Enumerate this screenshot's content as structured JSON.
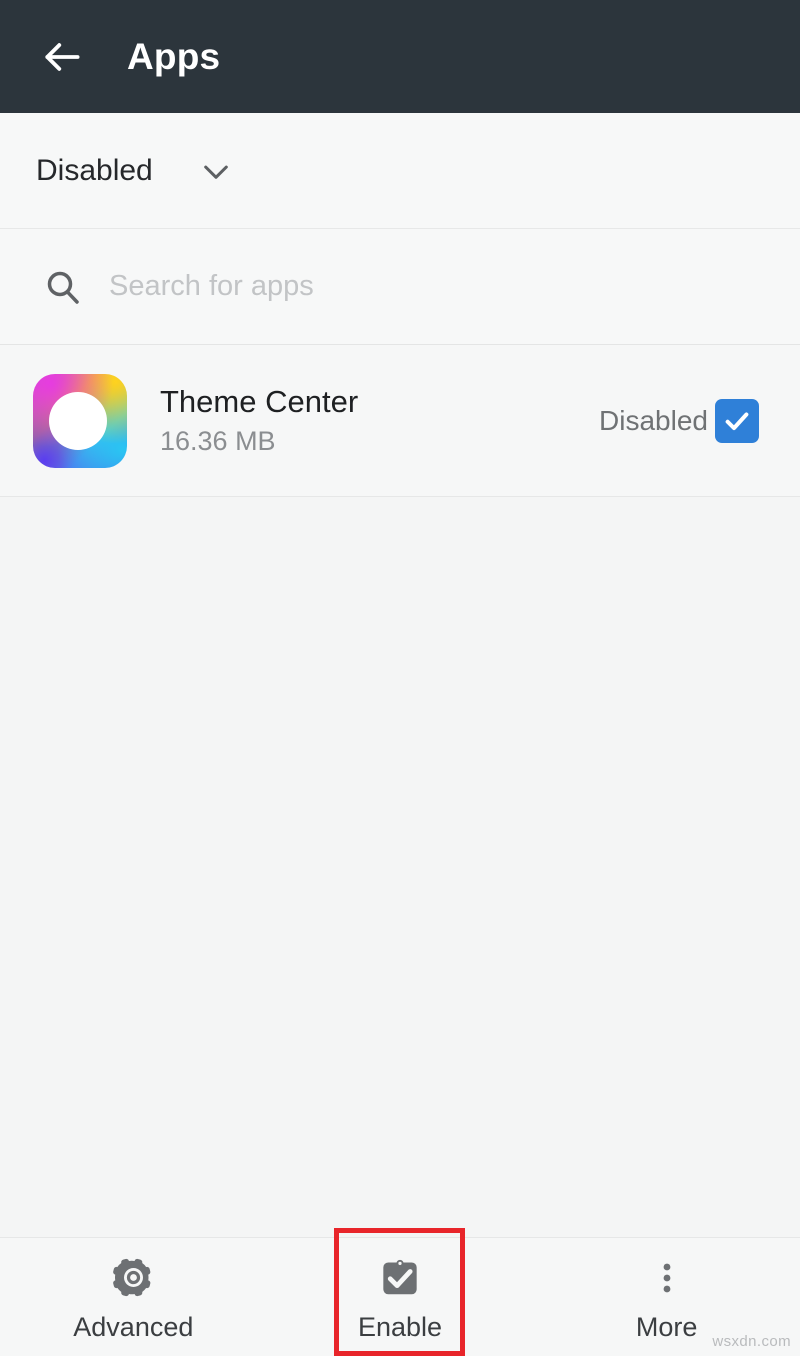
{
  "header": {
    "title": "Apps",
    "back_icon": "arrow-left-icon"
  },
  "filter": {
    "label": "Disabled",
    "chevron_icon": "chevron-down-icon"
  },
  "search": {
    "icon": "search-icon",
    "value": "",
    "placeholder": "Search for apps"
  },
  "app_list": {
    "items": [
      {
        "name": "Theme Center",
        "size": "16.36 MB",
        "state": "Disabled",
        "checked": true,
        "icon": "theme-center-app-icon"
      }
    ]
  },
  "bottom_bar": {
    "items": [
      {
        "label": "Advanced",
        "icon": "gear-icon"
      },
      {
        "label": "Enable",
        "icon": "clipboard-check-icon"
      },
      {
        "label": "More",
        "icon": "overflow-menu-icon"
      }
    ]
  },
  "annotation": {
    "highlight_target": "Enable",
    "highlight_color": "#e8252a"
  },
  "watermark": {
    "text": "wsxdn.com"
  },
  "colors": {
    "appbar": "#2c353c",
    "background": "#f4f5f5",
    "accent_checkbox": "#2f80d8",
    "icon_gray": "#6d7073",
    "highlight": "#e8252a"
  }
}
